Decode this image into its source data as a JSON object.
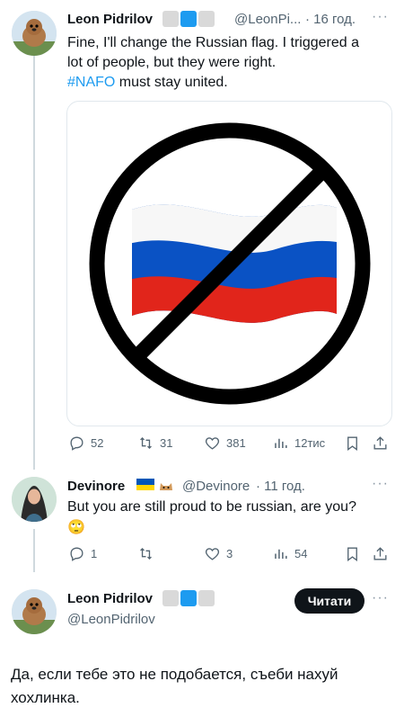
{
  "tweet1": {
    "author": "Leon Pidrilov",
    "handle": "@LeonPi...",
    "time": "· 16 год.",
    "text_line1": "Fine, I'll change the Russian flag. I triggered a",
    "text_line2": "lot of people, but they were right.",
    "hashtag": "#NAFO",
    "text_after_hashtag": " must stay united.",
    "stats": {
      "replies": "52",
      "retweets": "31",
      "likes": "381",
      "views": "12тис"
    }
  },
  "tweet2": {
    "author": "Devinore",
    "handle": "@Devinore",
    "time": "· 11 год.",
    "text": "But you are still proud to be russian, are you?",
    "emoji": "🙄",
    "stats": {
      "replies": "1",
      "retweets": "",
      "likes": "3",
      "views": "54"
    }
  },
  "tweet3": {
    "author": "Leon Pidrilov",
    "handle": "@LeonPidrilov",
    "follow_button": "Читати",
    "text_line1": "Да, если тебе это не подобается, съеби нахуй",
    "text_line2": "хохлинка."
  },
  "colors": {
    "accent": "#1d9bf0",
    "muted": "#536471",
    "flag_white": "#ffffff",
    "flag_blue": "#0a52c4",
    "flag_red": "#e1251b"
  },
  "icons": [
    "reply-icon",
    "retweet-icon",
    "like-icon",
    "views-icon",
    "bookmark-icon",
    "share-icon",
    "more-icon"
  ]
}
